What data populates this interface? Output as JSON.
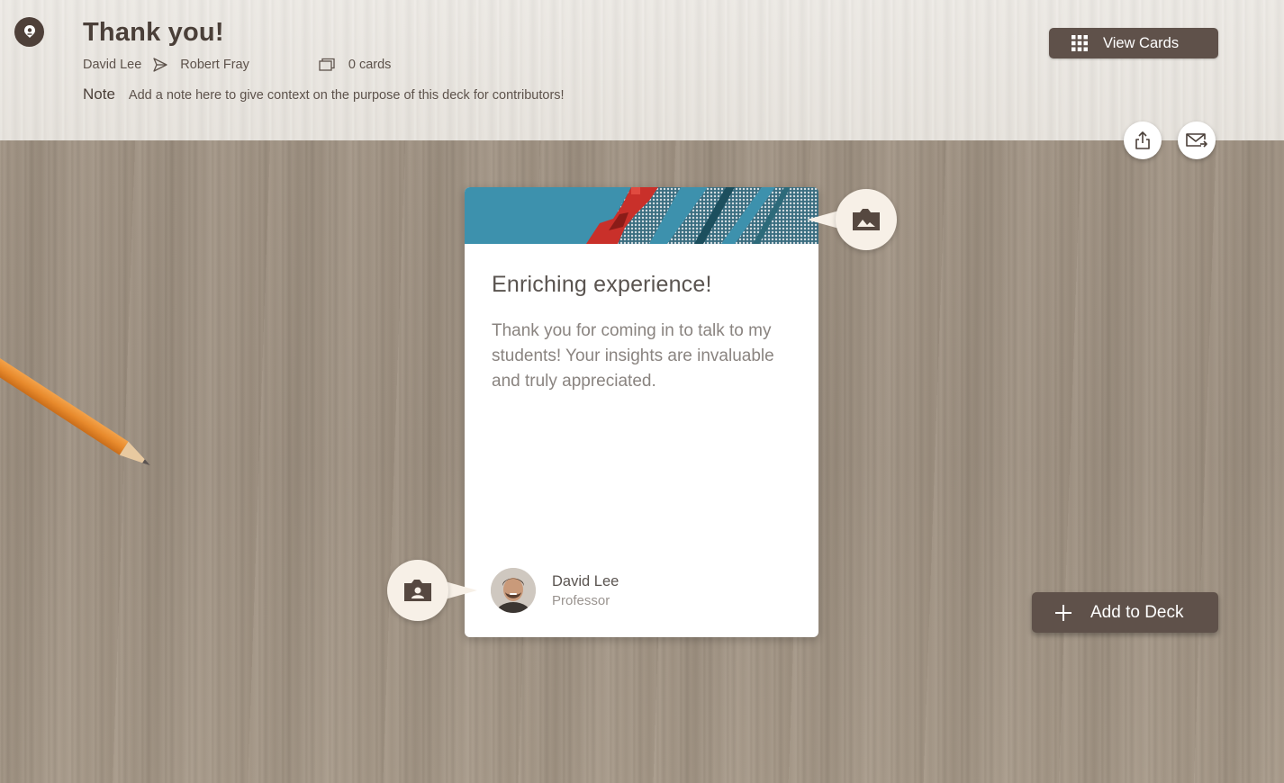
{
  "header": {
    "title": "Thank you!",
    "from": "David Lee",
    "to": "Robert Fray",
    "card_count": "0 cards",
    "note_label": "Note",
    "note_text": "Add a note here to give context on the purpose of this deck for contributors!"
  },
  "toolbar": {
    "view_cards_label": "View Cards",
    "share_icon": "share-icon",
    "mail_icon": "mail-forward-icon"
  },
  "card": {
    "heading": "Enriching experience!",
    "body": "Thank you for coming in to talk to my students! Your insights are invaluable and truly appreciated.",
    "author_name": "David Lee",
    "author_role": "Professor"
  },
  "actions": {
    "add_to_deck_label": "Add to Deck"
  },
  "colors": {
    "button_bg": "#5f514a",
    "bubble_bg": "#f7f0e7",
    "header_bg": "#e8e5e0",
    "desk_bg": "#a19383"
  }
}
